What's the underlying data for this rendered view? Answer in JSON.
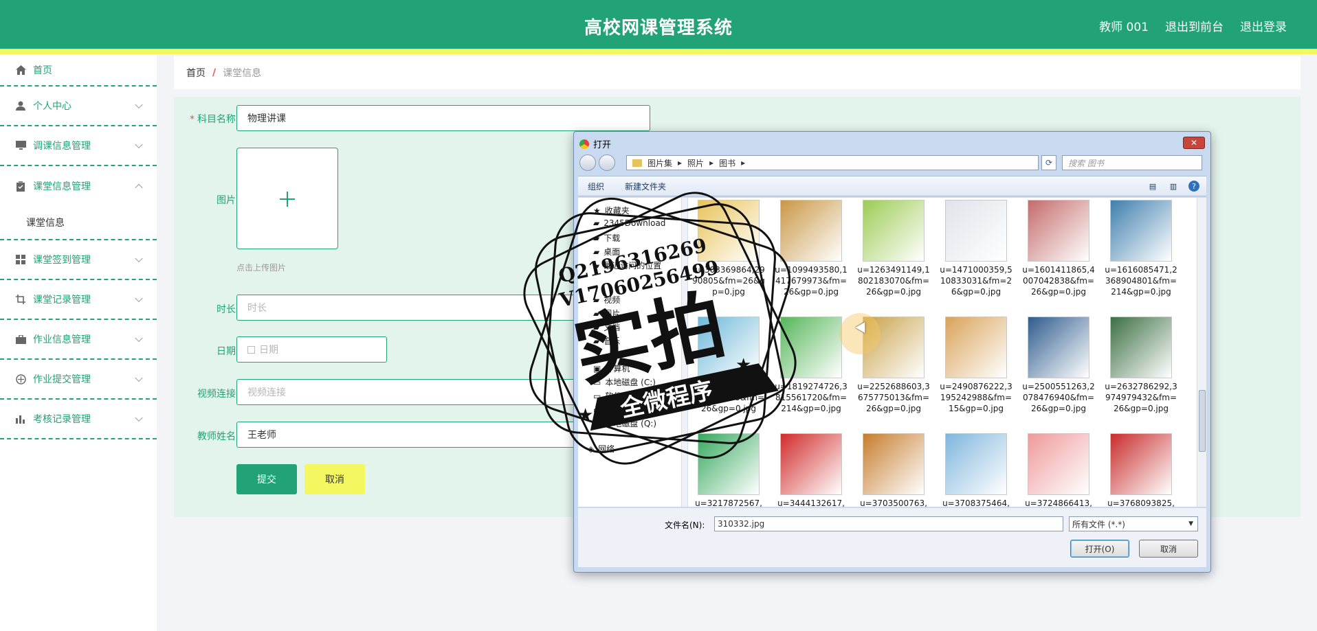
{
  "header": {
    "title": "高校网课管理系统",
    "links": [
      "教师 001",
      "退出到前台",
      "退出登录"
    ]
  },
  "sidebar": {
    "items": [
      {
        "label": "首页",
        "icon": "home-icon"
      },
      {
        "label": "个人中心",
        "icon": "user-icon"
      },
      {
        "label": "调课信息管理",
        "icon": "monitor-icon"
      },
      {
        "label": "课堂信息管理",
        "icon": "clipboard-icon"
      },
      {
        "label": "课堂签到管理",
        "icon": "grid-icon"
      },
      {
        "label": "课堂记录管理",
        "icon": "crop-icon"
      },
      {
        "label": "作业信息管理",
        "icon": "briefcase-icon"
      },
      {
        "label": "作业提交管理",
        "icon": "compass-icon"
      },
      {
        "label": "考核记录管理",
        "icon": "bar-chart-icon"
      }
    ],
    "submenu": "课堂信息"
  },
  "breadcrumb": {
    "home": "首页",
    "separator": "/",
    "current": "课堂信息"
  },
  "form": {
    "subject_label": "科目名称",
    "subject_value": "物理讲课",
    "image_label": "图片",
    "upload_tip": "点击上传图片",
    "duration_label": "时长",
    "duration_placeholder": "时长",
    "date_label": "日期",
    "date_placeholder": "日期",
    "video_label": "视频连接",
    "video_placeholder": "视频连接",
    "teacher_label": "教师姓名",
    "teacher_value": "王老师",
    "submit": "提交",
    "cancel": "取消"
  },
  "dialog": {
    "title": "打开",
    "path": [
      "图片集",
      "照片",
      "图书"
    ],
    "search_placeholder": "搜索 图书",
    "toolbar": {
      "organize": "组织",
      "new_folder": "新建文件夹"
    },
    "nav": [
      "收藏夹",
      "2345Download",
      "下载",
      "桌面",
      "最近访问的位置",
      "视频",
      "图片",
      "文档",
      "音乐",
      "计算机",
      "本地磁盘 (C:)",
      "软件 (D:)",
      "文档 (E:)",
      "本地磁盘 (Q:)",
      "网络"
    ],
    "files": [
      {
        "name": "u=303369864,2990805&fm=26&gp=0.jpg",
        "color": "#e8c35a"
      },
      {
        "name": "u=1099493580,1417679973&fm=26&gp=0.jpg",
        "color": "#c99745"
      },
      {
        "name": "u=1263491149,1802183070&fm=26&gp=0.jpg",
        "color": "#9ccc55"
      },
      {
        "name": "u=1471000359,510833031&fm=26&gp=0.jpg",
        "color": "#dfe4ea"
      },
      {
        "name": "u=1601411865,4007042838&fm=26&gp=0.jpg",
        "color": "#c46b6b"
      },
      {
        "name": "u=1616085471,2368904801&fm=214&gp=0.jpg",
        "color": "#3f7fae"
      },
      {
        "name": "u=1771332299,3015606998&fm=26&gp=0.jpg",
        "color": "#6fb9d9"
      },
      {
        "name": "u=1819274726,3815561720&fm=214&gp=0.jpg",
        "color": "#56b65a"
      },
      {
        "name": "u=2252688603,3675775013&fm=26&gp=0.jpg",
        "color": "#c8a24a"
      },
      {
        "name": "u=2490876222,3195242988&fm=15&gp=0.jpg",
        "color": "#d9a35a"
      },
      {
        "name": "u=2500551263,2078476940&fm=26&gp=0.jpg",
        "color": "#2f5c8e"
      },
      {
        "name": "u=2632786292,3974979432&fm=26&gp=0.jpg",
        "color": "#3c6f44"
      },
      {
        "name": "u=3217872567,",
        "color": "#37a85e"
      },
      {
        "name": "u=3444132617,",
        "color": "#d12b2b"
      },
      {
        "name": "u=3703500763,",
        "color": "#c67d2e"
      },
      {
        "name": "u=3708375464,",
        "color": "#7fb6dd"
      },
      {
        "name": "u=3724866413,",
        "color": "#ee9a9a"
      },
      {
        "name": "u=3768093825,",
        "color": "#c92c2c"
      }
    ],
    "filename_label": "文件名(N):",
    "filename_value": "310332.jpg",
    "filetype": "所有文件 (*.*)",
    "open_button": "打开(O)",
    "cancel_button": "取消"
  },
  "watermark": {
    "line1": "Q2196316269",
    "line2": "V17060256499",
    "main": "实拍",
    "banner": "全微程序"
  },
  "colors": {
    "primary": "#21a277",
    "accent": "#f4f75f",
    "panel": "#e3f4ed"
  }
}
